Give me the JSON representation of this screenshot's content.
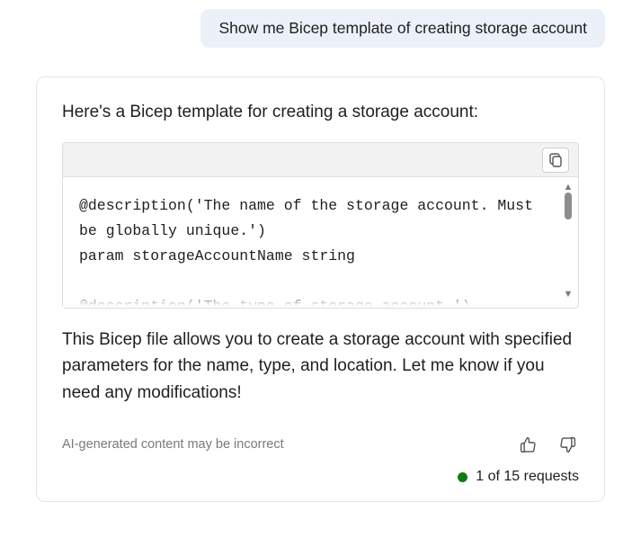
{
  "user": {
    "message": "Show me Bicep template of creating storage account"
  },
  "assistant": {
    "intro": "Here's a Bicep template for creating a storage account:",
    "code": "@description('The name of the storage account. Must be globally unique.')\nparam storageAccountName string\n\n@description('The type of storage account.')",
    "outro": "This Bicep file allows you to create a storage account with specified parameters for the name, type, and location. Let me know if you need any modifications!"
  },
  "disclaimer": "AI-generated content may be incorrect",
  "requests": "1 of 15 requests",
  "colors": {
    "status_ok": "#107c10",
    "user_bubble": "#ecf0f8"
  }
}
